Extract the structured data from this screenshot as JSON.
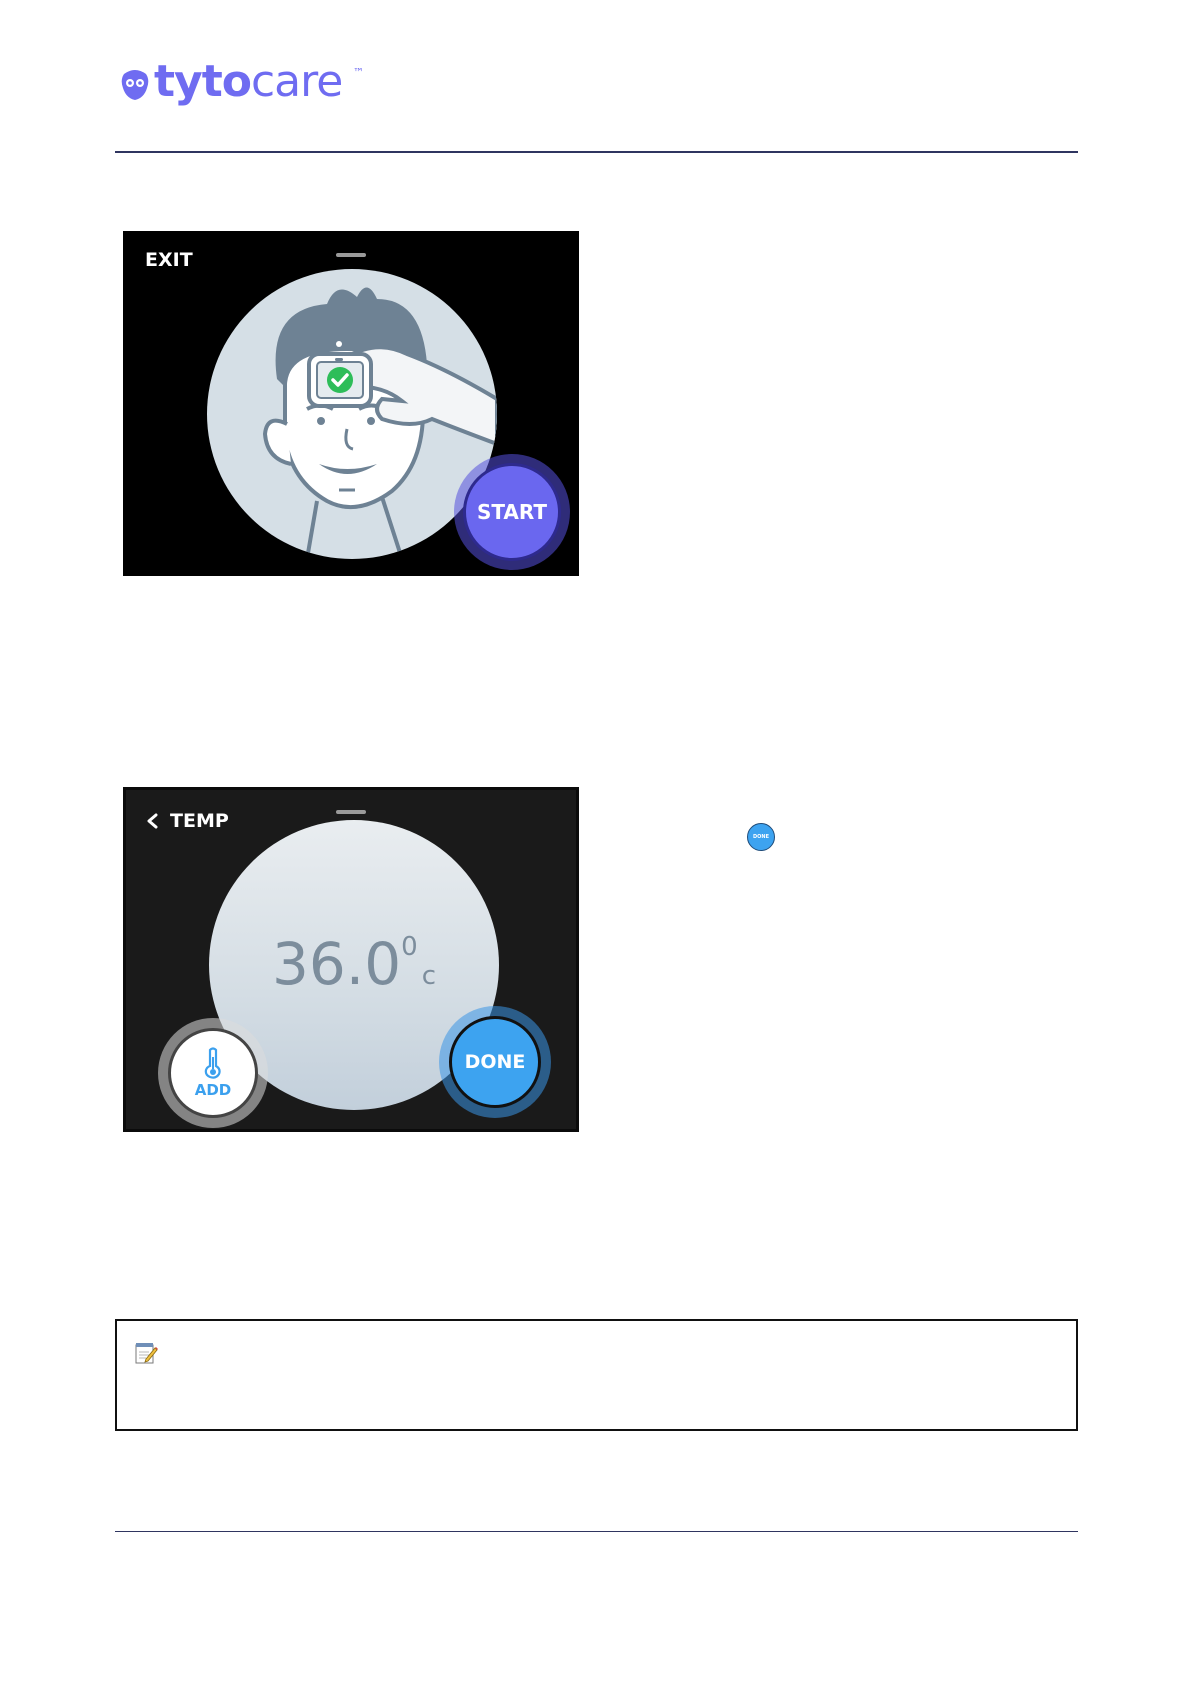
{
  "header": {
    "logo": {
      "word_bold": "tyto",
      "word_regular": "care",
      "trademark": "™",
      "color": "#6f6cf1"
    }
  },
  "screen1": {
    "exit_label": "EXIT",
    "start_label": "START",
    "accent_color": "#6a67ef"
  },
  "screen2": {
    "back_label": "TEMP",
    "reading_value": "36.0",
    "reading_degree": "0",
    "reading_unit": "c",
    "add_label": "ADD",
    "done_label": "DONE",
    "accent_color": "#3da3f0"
  },
  "inline_done_icon": {
    "label": "DONE"
  },
  "note": {
    "icon": "notepad-icon"
  }
}
